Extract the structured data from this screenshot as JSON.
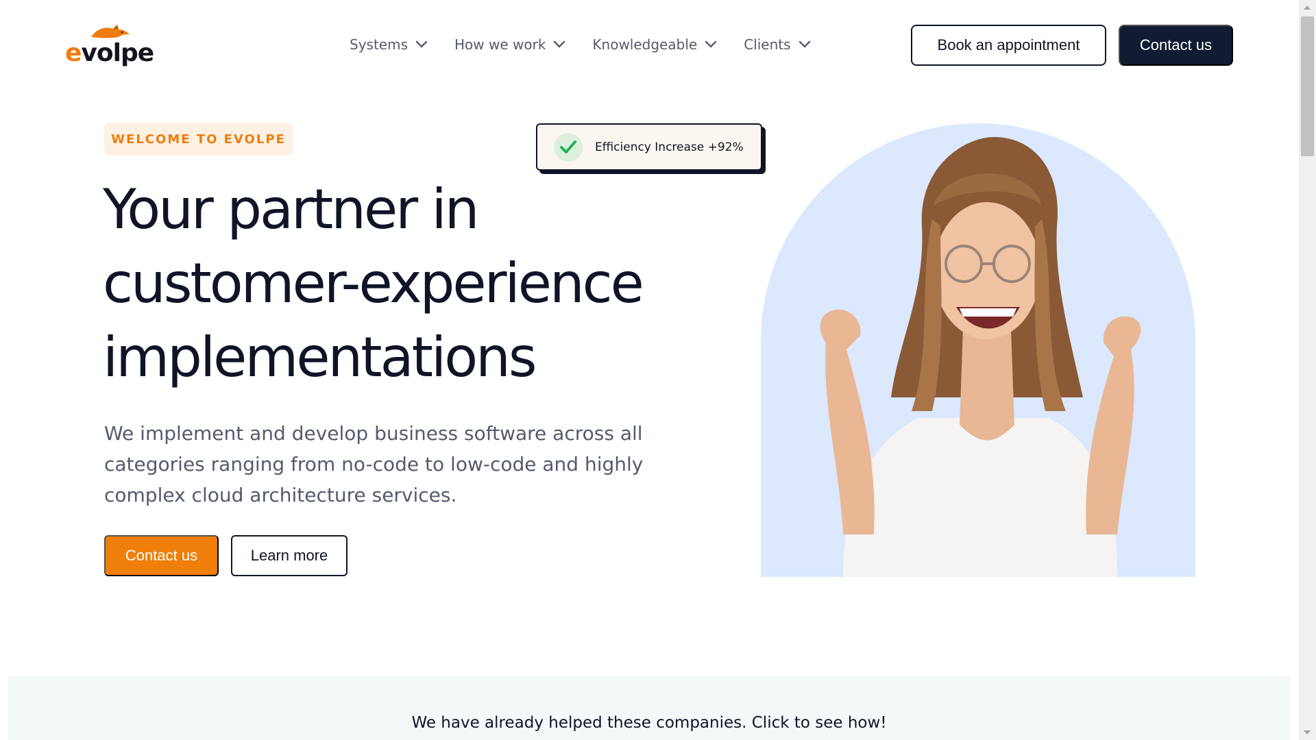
{
  "brand": {
    "logo_first": "e",
    "logo_rest": "volpe",
    "accent": "#ee7d0e",
    "dark": "#111c32"
  },
  "nav": {
    "items": [
      {
        "label": "Systems",
        "icon": "chevron-down-icon"
      },
      {
        "label": "How we work",
        "icon": "chevron-down-icon"
      },
      {
        "label": "Knowledgeable",
        "icon": "chevron-down-icon"
      },
      {
        "label": "Clients",
        "icon": "chevron-down-icon"
      }
    ],
    "book_label": "Book an appointment",
    "contact_label": "Contact us"
  },
  "hero": {
    "badge": "WELCOME TO EVOLPE",
    "title_lines": [
      "Your partner in",
      "customer-experience",
      "implementations"
    ],
    "description_lines": [
      "We implement and develop business software across all",
      "categories ranging from no-code to low-code and highly",
      "complex cloud architecture services."
    ],
    "primary_cta": "Contact us",
    "secondary_cta": "Learn more",
    "stat_card": {
      "icon": "check-icon",
      "text": "Efficiency Increase +92%"
    },
    "image_bg": "#dbe8fd"
  },
  "clients": {
    "heading": "We have already helped these companies. Click to see how!"
  }
}
